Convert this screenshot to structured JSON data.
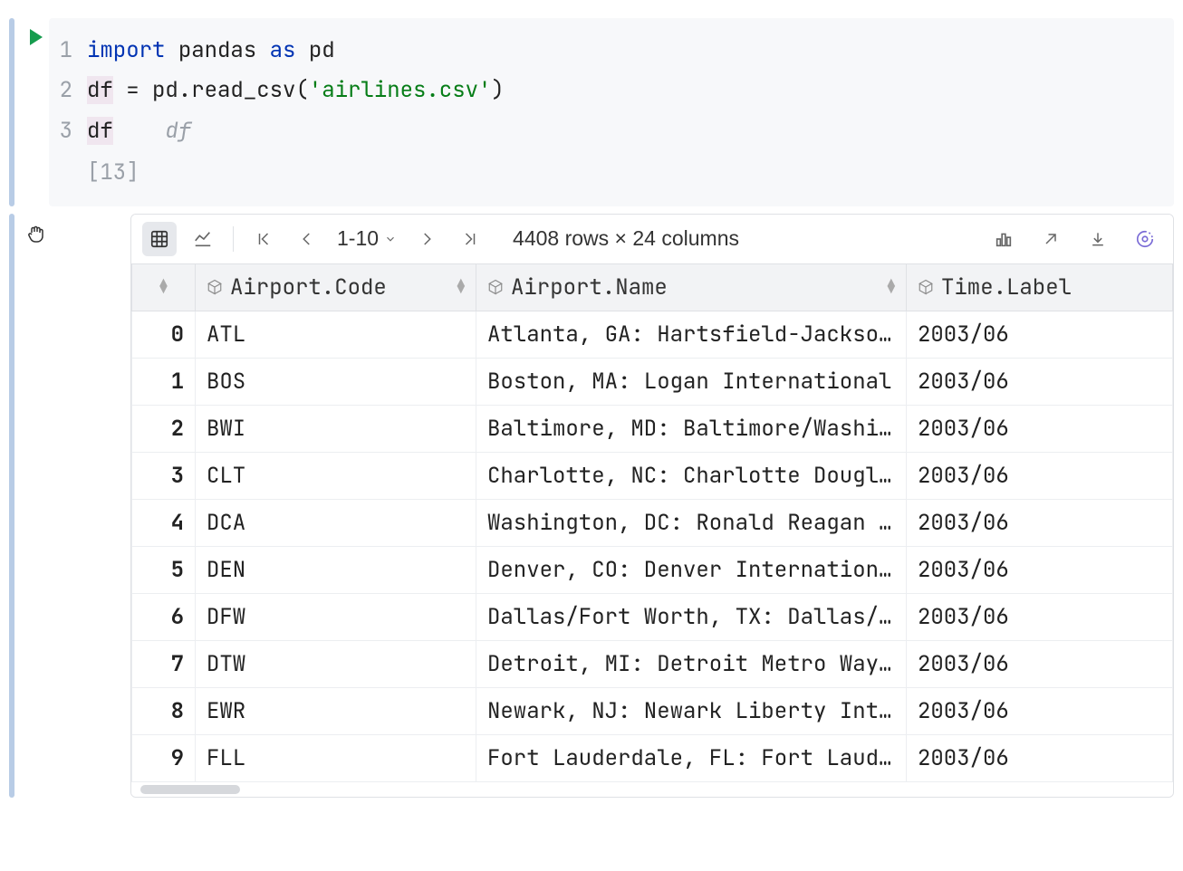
{
  "code": {
    "line1": {
      "import": "import",
      "pkg": "pandas",
      "as": "as",
      "alias": "pd"
    },
    "line2": {
      "var": "df",
      "assign": " = pd.read_csv(",
      "str": "'airlines.csv'",
      "close": ")"
    },
    "line3": {
      "var": "df",
      "hint": "df"
    },
    "gutter": [
      "1",
      "2",
      "3"
    ],
    "exec_count": "[13]"
  },
  "toolbar": {
    "page_range": "1-10",
    "summary": "4408 rows × 24 columns"
  },
  "table": {
    "columns": [
      "Airport.Code",
      "Airport.Name",
      "Time.Label"
    ],
    "rows": [
      {
        "idx": "0",
        "code": "ATL",
        "name": "Atlanta, GA: Hartsfield-Jackson Atlanta International",
        "time": "2003/06"
      },
      {
        "idx": "1",
        "code": "BOS",
        "name": "Boston, MA: Logan International",
        "time": "2003/06"
      },
      {
        "idx": "2",
        "code": "BWI",
        "name": "Baltimore, MD: Baltimore/Washington International",
        "time": "2003/06"
      },
      {
        "idx": "3",
        "code": "CLT",
        "name": "Charlotte, NC: Charlotte Douglas International",
        "time": "2003/06"
      },
      {
        "idx": "4",
        "code": "DCA",
        "name": "Washington, DC: Ronald Reagan Washington National",
        "time": "2003/06"
      },
      {
        "idx": "5",
        "code": "DEN",
        "name": "Denver, CO: Denver International",
        "time": "2003/06"
      },
      {
        "idx": "6",
        "code": "DFW",
        "name": "Dallas/Fort Worth, TX: Dallas/Fort Worth International",
        "time": "2003/06"
      },
      {
        "idx": "7",
        "code": "DTW",
        "name": "Detroit, MI: Detroit Metro Wayne County",
        "time": "2003/06"
      },
      {
        "idx": "8",
        "code": "EWR",
        "name": "Newark, NJ: Newark Liberty International",
        "time": "2003/06"
      },
      {
        "idx": "9",
        "code": "FLL",
        "name": "Fort Lauderdale, FL: Fort Lauderdale-Hollywood International",
        "time": "2003/06"
      }
    ]
  }
}
